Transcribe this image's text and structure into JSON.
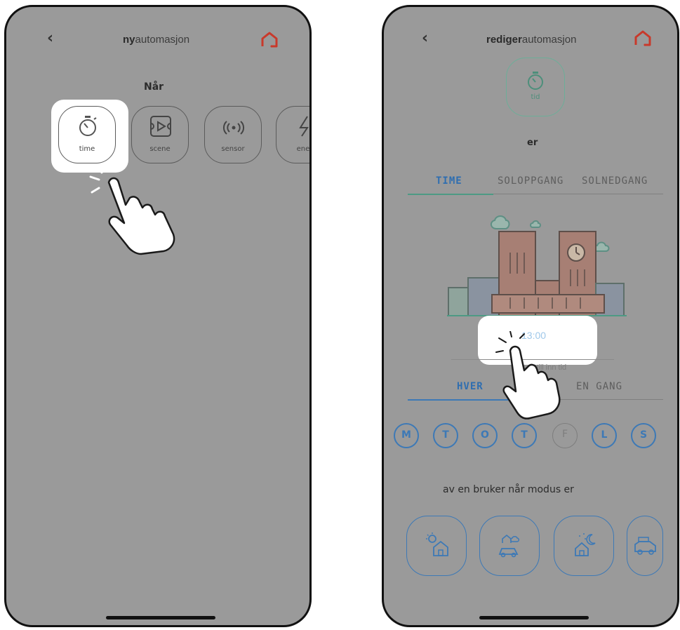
{
  "left_screen": {
    "header": {
      "title_bold": "ny",
      "title_rest": "automasjon",
      "back_glyph": "‹"
    },
    "section_label": "Når",
    "triggers": [
      {
        "label": "time",
        "icon": "stopwatch-icon"
      },
      {
        "label": "scene",
        "icon": "film-frame-icon"
      },
      {
        "label": "sensor",
        "icon": "signal-waves-icon"
      },
      {
        "label": "ener",
        "icon": "lightning-icon"
      }
    ]
  },
  "right_screen": {
    "header": {
      "title_bold": "rediger",
      "title_rest": "automasjon",
      "back_glyph": "‹"
    },
    "selected_trigger": {
      "label": "tid",
      "icon": "stopwatch-icon"
    },
    "connector": "er",
    "time_tabs": [
      {
        "label": "TIME",
        "active": true
      },
      {
        "label": "SOLOPPGANG",
        "active": false
      },
      {
        "label": "SOLNEDGANG",
        "active": false
      }
    ],
    "time_value": "13:00",
    "time_hint": "Still inn tid",
    "repeat_tabs": [
      {
        "label": "HVER",
        "active": true
      },
      {
        "label": "EN GANG",
        "active": false
      }
    ],
    "days": [
      {
        "label": "M",
        "on": true
      },
      {
        "label": "T",
        "on": true
      },
      {
        "label": "O",
        "on": true
      },
      {
        "label": "T",
        "on": true
      },
      {
        "label": "F",
        "on": false
      },
      {
        "label": "L",
        "on": true
      },
      {
        "label": "S",
        "on": true
      }
    ],
    "mode_label": "av en bruker når modus er",
    "modes": [
      "day-home-icon",
      "away-car-icon",
      "night-home-icon",
      "vacation-car-icon"
    ]
  },
  "colors": {
    "overlay": "#9a9a9a",
    "accent_blue": "#3d79b6",
    "accent_green": "#6cae98",
    "brand_red": "#c8392b"
  }
}
